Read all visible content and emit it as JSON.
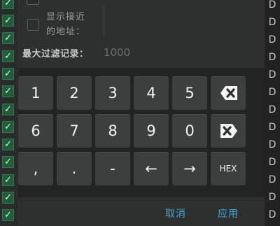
{
  "background": {
    "check_glyph": "✓",
    "right_letter": "D"
  },
  "filter": {
    "near_address_label_line1": "显示接近",
    "near_address_label_line2": "的地址：",
    "max_records_label": "最大过滤记录：",
    "max_records_value": "1000"
  },
  "keyboard": {
    "row1": [
      "1",
      "2",
      "3",
      "4",
      "5"
    ],
    "row2": [
      "6",
      "7",
      "8",
      "9",
      "0"
    ],
    "row3": [
      ",",
      ".",
      "-",
      "←",
      "→",
      "HEX"
    ]
  },
  "buttons": {
    "cancel": "取消",
    "apply": "应用"
  },
  "colors": {
    "accent": "#43a8d4",
    "key_bg": "#3d3e3e",
    "check_green": "#1e5f3a"
  }
}
